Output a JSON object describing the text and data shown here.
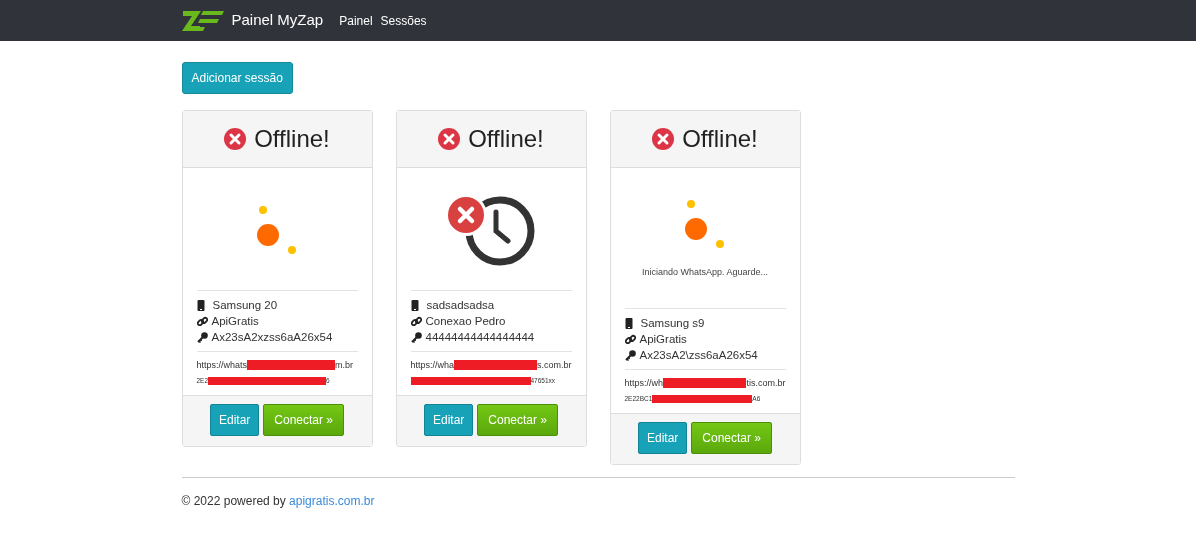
{
  "navbar": {
    "brand": "Painel MyZap",
    "links": [
      {
        "label": "Painel"
      },
      {
        "label": "Sessões"
      }
    ]
  },
  "add_button": "Adicionar sessão",
  "sessions": [
    {
      "status": "Offline!",
      "kind": "loading",
      "device": "Samsung 20",
      "connection": "ApiGratis",
      "key": "Ax23sA2xzss6aA26x54",
      "url": {
        "before": "https://whats",
        "after": "m.br"
      },
      "token": {
        "before": "2E2",
        "after": "6"
      },
      "buttons": [
        "Editar",
        "Conectar »"
      ]
    },
    {
      "status": "Offline!",
      "kind": "timeout",
      "device": "sadsadsadsa",
      "connection": "Conexao Pedro",
      "key": "44444444444444444",
      "url": {
        "before": "https://wha",
        "after": "s.com.br"
      },
      "token": {
        "after": "47651xx"
      },
      "buttons": [
        "Editar",
        "Conectar »"
      ]
    },
    {
      "status": "Offline!",
      "kind": "loading",
      "message": "Iniciando WhatsApp. Aguarde...",
      "device": "Samsung s9",
      "connection": "ApiGratis",
      "key": "Ax23sA2\\zss6aA26x54",
      "url": {
        "before": "https://wh",
        "after": "tis.com.br"
      },
      "token": {
        "before": "2E22BC1",
        "after": "A6"
      },
      "buttons": [
        "Editar",
        "Conectar »"
      ]
    }
  ],
  "footer": {
    "text": "© 2022 powered by",
    "link": "apigratis.com.br"
  }
}
